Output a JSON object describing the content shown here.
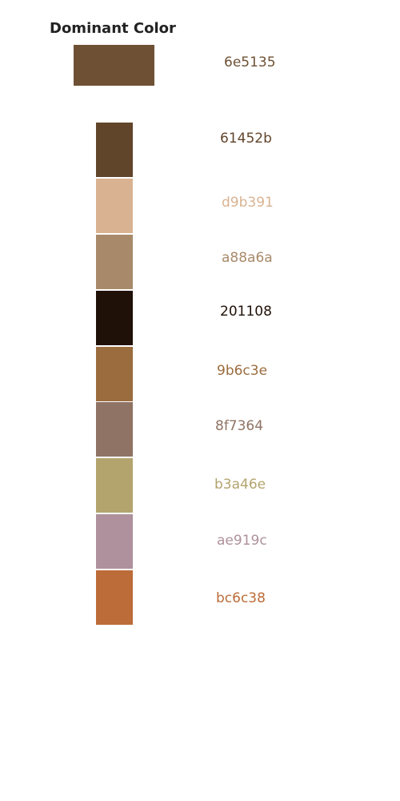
{
  "header": {
    "title": "Dominant Color"
  },
  "dominant": {
    "hex": "6e5135",
    "color": "#6e5135"
  },
  "palette": [
    {
      "hex": "61452b",
      "color": "#61452b"
    },
    {
      "hex": "d9b391",
      "color": "#d9b391"
    },
    {
      "hex": "a88a6a",
      "color": "#a88a6a"
    },
    {
      "hex": "201108",
      "color": "#201108"
    },
    {
      "hex": "9b6c3e",
      "color": "#9b6c3e"
    },
    {
      "hex": "8f7364",
      "color": "#8f7364"
    },
    {
      "hex": "b3a46e",
      "color": "#b3a46e"
    },
    {
      "hex": "ae919c",
      "color": "#ae919c"
    },
    {
      "hex": "bc6c38",
      "color": "#bc6c38"
    }
  ]
}
